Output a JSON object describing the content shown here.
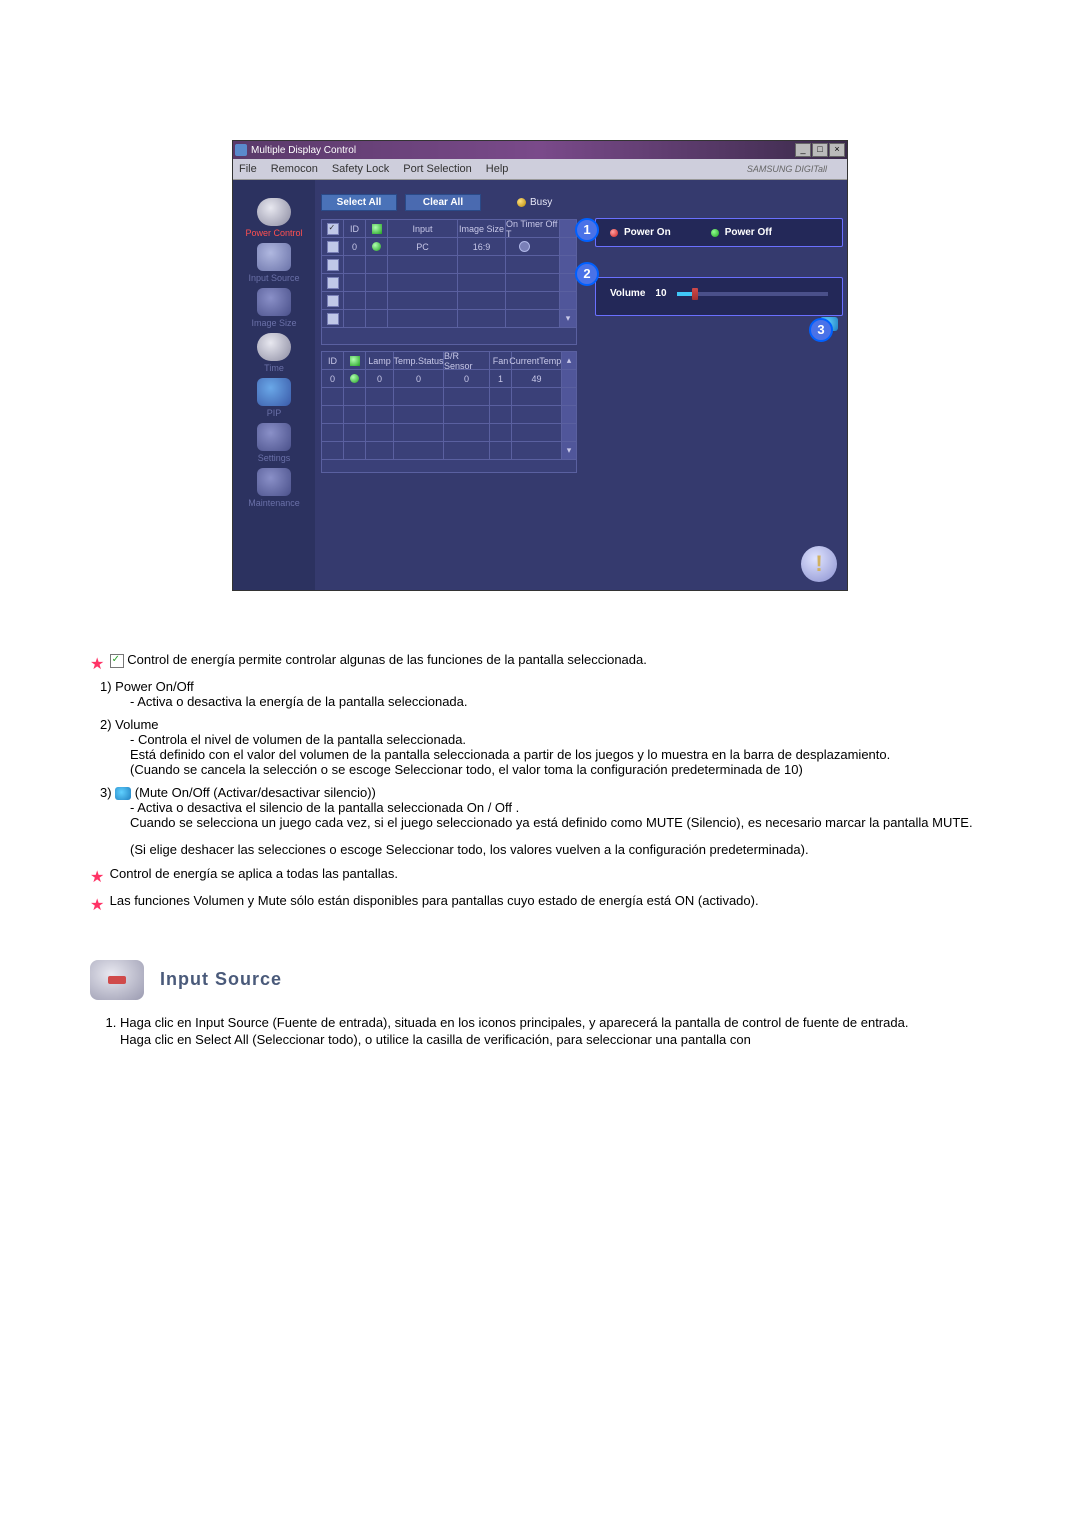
{
  "app": {
    "title": "Multiple Display Control",
    "brand": "SAMSUNG DIGITall",
    "menu": {
      "file": "File",
      "remocon": "Remocon",
      "safety": "Safety Lock",
      "port": "Port Selection",
      "help": "Help"
    },
    "btn_select_all": "Select All",
    "btn_clear_all": "Clear All",
    "busy": "Busy"
  },
  "sidebar": {
    "power_control": "Power Control",
    "input_source": "Input Source",
    "image_size": "Image Size",
    "time": "Time",
    "pip": "PIP",
    "settings": "Settings",
    "maintenance": "Maintenance"
  },
  "topTable": {
    "head": {
      "id": "ID",
      "input": "Input",
      "image_size": "Image Size",
      "on_timer": "On Timer Off T"
    },
    "row0": {
      "id": "0",
      "input": "PC",
      "image_size": "16:9"
    }
  },
  "botTable": {
    "head": {
      "id": "ID",
      "lamp": "Lamp",
      "temp_status": "Temp.Status",
      "br_sensor": "B/R Sensor",
      "fan": "Fan",
      "current_temp": "CurrentTemp."
    },
    "row0": {
      "id": "0",
      "lamp": "0",
      "temp_status": "0",
      "br_sensor": "0",
      "fan": "1",
      "current_temp": "49"
    }
  },
  "controls": {
    "power_on": "Power On",
    "power_off": "Power Off",
    "volume_label": "Volume",
    "volume_value": "10"
  },
  "callouts": {
    "one": "1",
    "two": "2",
    "three": "3"
  },
  "doc": {
    "intro": "Control de energía permite controlar algunas de las funciones de la pantalla seleccionada.",
    "n1_title": "1)  Power On/Off",
    "n1_body": "- Activa o desactiva la energía de la pantalla seleccionada.",
    "n2_title": "2)  Volume",
    "n2_b1": "- Controla el nivel de volumen de la pantalla seleccionada.",
    "n2_b2": "Está definido con el valor del volumen de la pantalla seleccionada a partir de los juegos y lo muestra en la barra de desplazamiento.",
    "n2_b3": "(Cuando se cancela la selección o se escoge Seleccionar todo, el valor toma la configuración predeterminada de 10)",
    "n3_title_prefix": "3)  ",
    "n3_title_suffix": "(Mute On/Off (Activar/desactivar silencio))",
    "n3_b1": "- Activa o desactiva el silencio de la pantalla seleccionada On / Off .",
    "n3_b2": "Cuando se selecciona un juego cada vez, si el juego seleccionado ya está definido como MUTE (Silencio), es necesario marcar la pantalla MUTE.",
    "n3_b3": "(Si elige deshacer las selecciones o escoge Seleccionar todo, los valores vuelven a la configuración predeterminada).",
    "note1": "Control de energía se aplica a todas las pantallas.",
    "note2": "Las funciones Volumen y Mute sólo están disponibles para pantallas cuyo estado de energía está ON (activado).",
    "section_heading": "Input Source",
    "is_1a": "Haga clic en Input Source (Fuente de entrada), situada en los iconos principales, y aparecerá la pantalla de control de fuente de entrada.",
    "is_1b": "Haga clic en Select All (Seleccionar todo), o utilice la casilla de verificación, para seleccionar una pantalla con"
  }
}
